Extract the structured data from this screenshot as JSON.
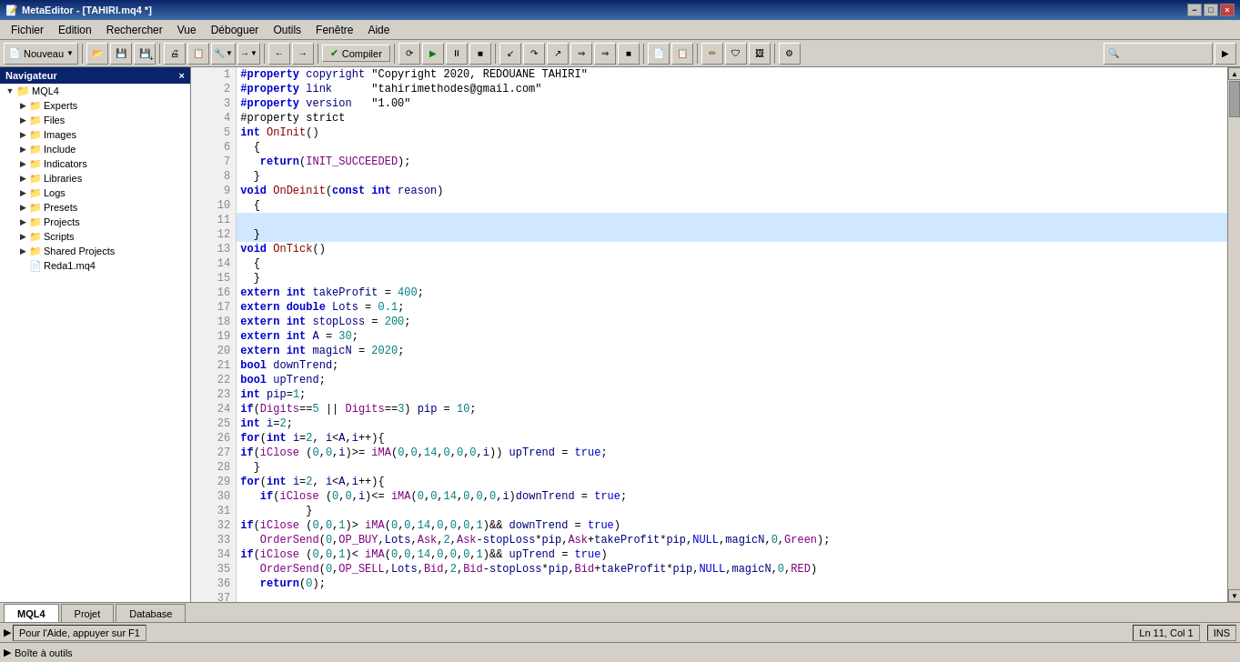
{
  "titlebar": {
    "title": "MetaEditor - [TAHIRI.mq4 *]",
    "minimize": "−",
    "maximize": "□",
    "close": "×"
  },
  "menu": {
    "items": [
      "Fichier",
      "Edition",
      "Rechercher",
      "Vue",
      "Déboguer",
      "Outils",
      "Fenêtre",
      "Aide"
    ]
  },
  "toolbar": {
    "new_label": "Nouveau",
    "compile_label": "Compiler"
  },
  "navigator": {
    "title": "Navigateur",
    "close": "×",
    "tree": [
      {
        "label": "MQL4",
        "level": 0,
        "type": "root",
        "expanded": true
      },
      {
        "label": "Experts",
        "level": 1,
        "type": "folder",
        "expanded": false
      },
      {
        "label": "Files",
        "level": 1,
        "type": "folder",
        "expanded": false
      },
      {
        "label": "Images",
        "level": 1,
        "type": "folder",
        "expanded": false
      },
      {
        "label": "Include",
        "level": 1,
        "type": "folder",
        "expanded": false
      },
      {
        "label": "Indicators",
        "level": 1,
        "type": "folder",
        "expanded": false
      },
      {
        "label": "Libraries",
        "level": 1,
        "type": "folder",
        "expanded": false
      },
      {
        "label": "Logs",
        "level": 1,
        "type": "folder",
        "expanded": false
      },
      {
        "label": "Presets",
        "level": 1,
        "type": "folder",
        "expanded": false
      },
      {
        "label": "Projects",
        "level": 1,
        "type": "folder",
        "expanded": false
      },
      {
        "label": "Scripts",
        "level": 1,
        "type": "folder",
        "expanded": false
      },
      {
        "label": "Shared Projects",
        "level": 1,
        "type": "folder-shared",
        "expanded": false
      },
      {
        "label": "Reda1.mq4",
        "level": 1,
        "type": "file",
        "expanded": false
      }
    ]
  },
  "tabs": {
    "bottom": [
      "MQL4",
      "Projet",
      "Database"
    ]
  },
  "status": {
    "left": "Pour l'Aide, appuyer sur F1",
    "position": "Ln 11, Col 1",
    "mode": "INS"
  },
  "bottom_strip": {
    "text": "Boîte à outils"
  },
  "code_lines": [
    {
      "num": 1,
      "content": "#property copyright \"Copyright 2020, REDOUANE TAHIRI\""
    },
    {
      "num": 2,
      "content": "#property link      \"tahirimethodes@gmail.com\""
    },
    {
      "num": 3,
      "content": "#property version   \"1.00\""
    },
    {
      "num": 4,
      "content": "#property strict"
    },
    {
      "num": 5,
      "content": "int OnInit()"
    },
    {
      "num": 6,
      "content": "  {"
    },
    {
      "num": 7,
      "content": "   return(INIT_SUCCEEDED);"
    },
    {
      "num": 8,
      "content": "  }"
    },
    {
      "num": 9,
      "content": "void OnDeinit(const int reason)"
    },
    {
      "num": 10,
      "content": "  {"
    },
    {
      "num": 11,
      "content": "",
      "highlighted": true
    },
    {
      "num": 12,
      "content": "  }",
      "highlighted": true
    },
    {
      "num": 13,
      "content": "void OnTick()"
    },
    {
      "num": 14,
      "content": "  {"
    },
    {
      "num": 15,
      "content": "  }"
    },
    {
      "num": 16,
      "content": "extern int takeProfit = 400;"
    },
    {
      "num": 17,
      "content": "extern double Lots = 0.1;"
    },
    {
      "num": 18,
      "content": "extern int stopLoss = 200;"
    },
    {
      "num": 19,
      "content": "extern int A = 30;"
    },
    {
      "num": 20,
      "content": "extern int magicN = 2020;"
    },
    {
      "num": 21,
      "content": "bool downTrend;"
    },
    {
      "num": 22,
      "content": "bool upTrend;"
    },
    {
      "num": 23,
      "content": "int pip=1;"
    },
    {
      "num": 24,
      "content": "if(Digits==5 || Digits==3) pip = 10;"
    },
    {
      "num": 25,
      "content": "int i=2;"
    },
    {
      "num": 26,
      "content": "for(int i=2, i<A,i++){"
    },
    {
      "num": 27,
      "content": "if(iClose (0,0,i)>= iMA(0,0,14,0,0,0,i)) upTrend = true;"
    },
    {
      "num": 28,
      "content": "  }"
    },
    {
      "num": 29,
      "content": "for(int i=2, i<A,i++){"
    },
    {
      "num": 30,
      "content": "   if(iClose (0,0,i)<= iMA(0,0,14,0,0,0,i)downTrend = true;"
    },
    {
      "num": 31,
      "content": "          }"
    },
    {
      "num": 32,
      "content": "if(iClose (0,0,1)> iMA(0,0,14,0,0,0,1)&& downTrend = true)"
    },
    {
      "num": 33,
      "content": "   OrderSend(0,OP_BUY,Lots,Ask,2,Ask-stopLoss*pip,Ask+takeProfit*pip,NULL,magicN,0,Green);"
    },
    {
      "num": 34,
      "content": "if(iClose (0,0,1)< iMA(0,0,14,0,0,0,1)&& upTrend = true)"
    },
    {
      "num": 35,
      "content": "   OrderSend(0,OP_SELL,Lots,Bid,2,Bid-stopLoss*pip,Bid+takeProfit*pip,NULL,magicN,0,RED)"
    },
    {
      "num": 36,
      "content": "   return(0);"
    },
    {
      "num": 37,
      "content": ""
    }
  ]
}
